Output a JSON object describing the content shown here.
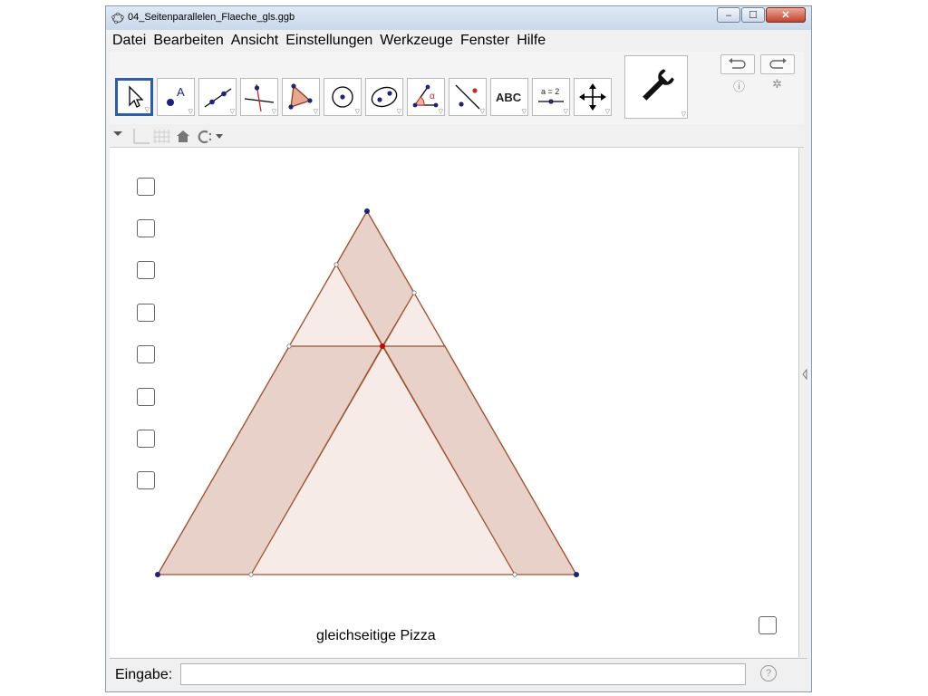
{
  "window": {
    "title": "04_Seitenparallelen_Flaeche_gls.ggb",
    "buttons": {
      "minimize": "‒",
      "maximize": "☐",
      "close": "✕"
    }
  },
  "menu": {
    "items": [
      "Datei",
      "Bearbeiten",
      "Ansicht",
      "Einstellungen",
      "Werkzeuge",
      "Fenster",
      "Hilfe"
    ]
  },
  "toolbar": {
    "tools": [
      {
        "name": "move-tool-icon",
        "active": true
      },
      {
        "name": "point-tool-icon"
      },
      {
        "name": "line-tool-icon"
      },
      {
        "name": "perpendicular-line-tool-icon"
      },
      {
        "name": "polygon-tool-icon"
      },
      {
        "name": "circle-tool-icon"
      },
      {
        "name": "ellipse-tool-icon"
      },
      {
        "name": "angle-tool-icon"
      },
      {
        "name": "reflect-tool-icon"
      },
      {
        "name": "text-tool-icon",
        "label": "ABC"
      },
      {
        "name": "slider-tool-icon",
        "label": "a = 2"
      },
      {
        "name": "move-graphics-view-tool-icon"
      }
    ],
    "customize_icon": "wrench-icon",
    "undo_icon": "undo-icon",
    "redo_icon": "redo-icon",
    "help_icon": "help-icon",
    "settings_icon": "gear-icon"
  },
  "canvas": {
    "label": "gleichseitige Pizza",
    "checkbox_count": 9,
    "colors": {
      "fill_light": "#f5e8e3",
      "fill_dark": "#e8d0c8",
      "stroke": "#a0522d",
      "vertex": "#1a237e",
      "center": "#cc0000"
    }
  },
  "input_bar": {
    "label": "Eingabe:",
    "value": ""
  }
}
